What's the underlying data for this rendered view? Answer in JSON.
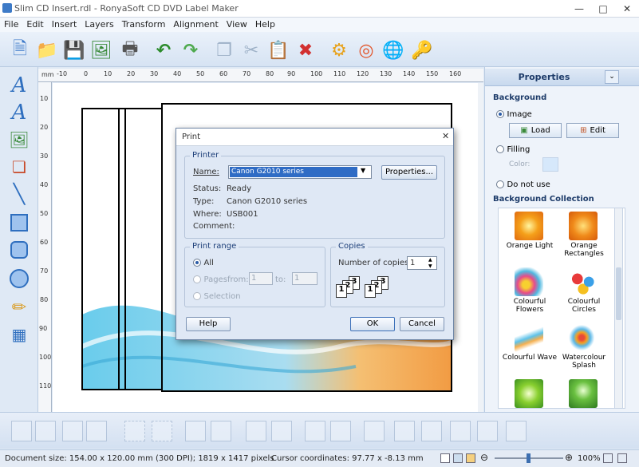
{
  "window": {
    "title": "Slim CD Insert.rdl - RonyaSoft CD DVD Label Maker"
  },
  "menu": [
    "File",
    "Edit",
    "Insert",
    "Layers",
    "Transform",
    "Alignment",
    "View",
    "Help"
  ],
  "ruler": {
    "unit": "mm",
    "h_ticks": [
      "-10",
      "0",
      "10",
      "20",
      "30",
      "40",
      "50",
      "60",
      "70",
      "80",
      "90",
      "100",
      "110",
      "120",
      "130",
      "140",
      "150",
      "160"
    ],
    "v_ticks": [
      "10",
      "20",
      "30",
      "40",
      "50",
      "60",
      "70",
      "80",
      "90",
      "100",
      "110"
    ]
  },
  "properties": {
    "header": "Properties",
    "background_section": "Background",
    "image_option": "Image",
    "load_label": "Load",
    "edit_label": "Edit",
    "filling_option": "Filling",
    "color_label": "Color:",
    "do_not_use_option": "Do not use",
    "collection_section": "Background Collection",
    "collection": [
      {
        "name": "Orange Light"
      },
      {
        "name": "Orange Rectangles"
      },
      {
        "name": "Colourful Flowers"
      },
      {
        "name": "Colourful Circles"
      },
      {
        "name": "Colourful Wave"
      },
      {
        "name": "Watercolour Splash"
      }
    ]
  },
  "dialog": {
    "title": "Print",
    "printer_group": "Printer",
    "name_label": "Name:",
    "name_value": "Canon G2010 series",
    "properties_button": "Properties...",
    "status_label": "Status:",
    "status_value": "Ready",
    "type_label": "Type:",
    "type_value": "Canon G2010 series",
    "where_label": "Where:",
    "where_value": "USB001",
    "comment_label": "Comment:",
    "range_group": "Print range",
    "all_option": "All",
    "pages_option": "Pages",
    "from_label": "from:",
    "from_value": "1",
    "to_label": "to:",
    "to_value": "1",
    "selection_option": "Selection",
    "copies_group": "Copies",
    "copies_label": "Number of copies:",
    "copies_value": "1",
    "help_button": "Help",
    "ok_button": "OK",
    "cancel_button": "Cancel"
  },
  "status": {
    "document_size": "Document size: 154.00 x 120.00 mm (300 DPI); 1819 x 1417 pixels",
    "cursor": "Cursor coordinates: 97.77 x -8.13 mm",
    "zoom": "100%"
  }
}
